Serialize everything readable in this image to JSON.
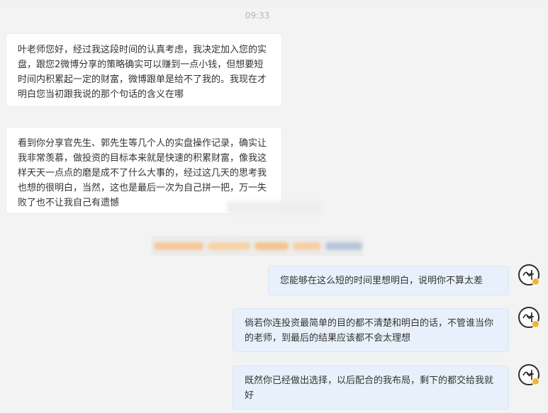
{
  "timestamp": "09:33",
  "messages": [
    {
      "direction": "incoming",
      "text": "叶老师您好，经过我这段时间的认真考虑，我决定加入您的实盘，跟您2微博分享的策略确实可以赚到一点小钱，但想要短时间内积累起一定的财富，微博跟单是给不了我的。我现在才明白您当初跟我说的那个句话的含义在哪"
    },
    {
      "direction": "incoming",
      "text": "看到你分享官先生、郭先生等几个人的实盘操作记录，确实让我非常羡慕，做投资的目标本来就是快速的积累财富，像我这样天天一点点的磨是成不了什么大事的，经过这几天的思考我也想的很明白，当然，这也是最后一次为自己拼一把，万一失败了也不让我自己有遗憾"
    },
    {
      "direction": "outgoing",
      "text": "您能够在这么短的时间里想明白，说明你不算太差"
    },
    {
      "direction": "outgoing",
      "text": "倘若你连投资最简单的目的都不清楚和明白的话，不管谁当你的老师，到最后的结果应该都不会太理想"
    },
    {
      "direction": "outgoing",
      "text": "既然你已经做出选择，以后配合的我布局，剩下的都交给我就好"
    }
  ],
  "colors": {
    "background": "#f3f3f3",
    "incoming_bubble": "#ffffff",
    "outgoing_bubble": "#e8f1fb",
    "text": "#333333",
    "timestamp": "#b5b5b5",
    "avatar_badge": "#f3b431"
  }
}
